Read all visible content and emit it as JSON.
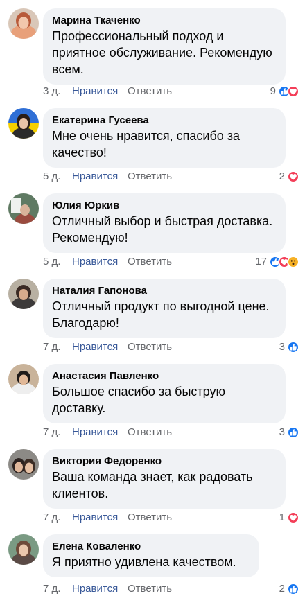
{
  "comments": [
    {
      "name": "Марина Ткаченко",
      "lines": [
        "Профессиональный подход и",
        "приятное обслуживание. Рекомендую",
        "всем."
      ],
      "time": "3 д.",
      "like": "Нравится",
      "reply": "Ответить",
      "count": "9",
      "reactions": [
        "like-icon",
        "love-icon"
      ]
    },
    {
      "name": "Екатерина Гусеева",
      "lines": [
        "Мне очень нравится, спасибо за",
        "качество!"
      ],
      "time": "5 д.",
      "like": "Нравится",
      "reply": "Ответить",
      "count": "2",
      "reactions": [
        "love-icon"
      ]
    },
    {
      "name": "Юлия Юркив",
      "lines": [
        "Отличный выбор и быстрая доставка.",
        "Рекомендую!"
      ],
      "time": "5 д.",
      "like": "Нравится",
      "reply": "Ответить",
      "count": "17",
      "reactions": [
        "like-icon",
        "love-icon",
        "wow-icon"
      ]
    },
    {
      "name": "Наталия Гапонова",
      "lines": [
        "Отличный продукт по выгодной цене.",
        "Благодарю!"
      ],
      "time": "7 д.",
      "like": "Нравится",
      "reply": "Ответить",
      "count": "3",
      "reactions": [
        "like-icon"
      ]
    },
    {
      "name": "Анастасия Павленко",
      "lines": [
        "Большое спасибо за быструю",
        "доставку."
      ],
      "time": "7 д.",
      "like": "Нравится",
      "reply": "Ответить",
      "count": "3",
      "reactions": [
        "like-icon"
      ]
    },
    {
      "name": "Виктория Федоренко",
      "lines": [
        "Ваша команда знает, как радовать",
        "клиентов."
      ],
      "time": "7 д.",
      "like": "Нравится",
      "reply": "Ответить",
      "count": "1",
      "reactions": [
        "love-icon"
      ]
    },
    {
      "name": "Елена Коваленко",
      "lines": [
        "Я приятно удивлена качеством."
      ],
      "time": "7 д.",
      "like": "Нравится",
      "reply": "Ответить",
      "count": "2",
      "reactions": [
        "like-icon"
      ]
    }
  ],
  "colors": {
    "bubble": "#f0f2f5",
    "link": "#385898",
    "meta": "#65676b",
    "like": "#1877f2",
    "love": "#f33e58",
    "wow": "#f7b125"
  }
}
